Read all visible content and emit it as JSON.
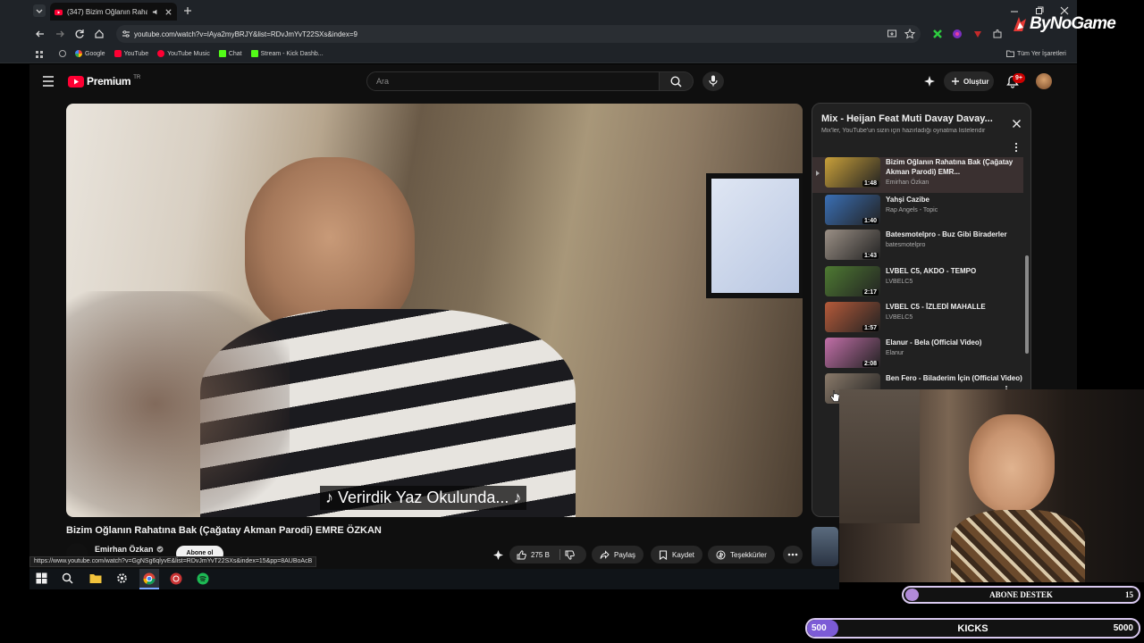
{
  "browser": {
    "tab_title": "(347) Bizim Oğlanın Rahatı",
    "url": "youtube.com/watch?v=lAya2myBRJY&list=RDvJmYvT22SXs&index=9",
    "bookmarks": [
      "Google",
      "YouTube",
      "YouTube Music",
      "Chat",
      "Stream - Kick Dashb..."
    ],
    "all_bookmarks": "Tüm Yer İşaretleri"
  },
  "youtube": {
    "logo": "Premium",
    "logo_sup": "TR",
    "search_placeholder": "Ara",
    "create_label": "Oluştur",
    "notif_count": "9+",
    "subtitle": "♪ Verirdik Yaz Okulunda... ♪",
    "video_title": "Bizim Oğlanın Rahatına Bak (Çağatay Akman Parodi) EMRE ÖZKAN",
    "channel": "Emirhan Özkan",
    "subscribe_label": "Abone ol",
    "likes": "275 B",
    "share_label": "Paylaş",
    "save_label": "Kaydet",
    "thanks_label": "Teşekkürler",
    "status_url": "https://www.youtube.com/watch?v=GgNSg6qlyvE&list=RDvJmYvT22SXs&index=15&pp=8AUBoAcB"
  },
  "playlist": {
    "title": "Mix - Heijan Feat Muti Davay Davay...",
    "subtitle": "Mix'ler, YouTube'un sizin için hazırladığı oynatma listeleridir",
    "items": [
      {
        "title": "Bizim Oğlanın Rahatına Bak (Çağatay Akman Parodi) EMR...",
        "channel": "Emirhan Özkan",
        "duration": "1:48",
        "color": "#c9a03a"
      },
      {
        "title": "Yahşi Cazibe",
        "channel": "Rap Angels - Topic",
        "duration": "1:40",
        "color": "#3a6fb5"
      },
      {
        "title": "Batesmotelpro - Buz Gibi Biraderler",
        "channel": "batesmotelpro",
        "duration": "1:43",
        "color": "#9a8f85"
      },
      {
        "title": "LVBEL C5, AKDO - TEMPO",
        "channel": "LVBELC5",
        "duration": "2:17",
        "color": "#4e7a32"
      },
      {
        "title": "LVBEL C5 - İZLEDİ MAHALLE",
        "channel": "LVBELC5",
        "duration": "1:57",
        "color": "#b55a3a"
      },
      {
        "title": "Elanur - Bela (Official Video)",
        "channel": "Elanur",
        "duration": "2:08",
        "color": "#c26fa8"
      },
      {
        "title": "Ben Fero - Biladerim İçin (Official Video)",
        "channel": "",
        "duration": "",
        "color": "#8a7a6a"
      }
    ]
  },
  "overlay": {
    "brand": "ByNoGame",
    "sub_goal_label": "ABONE DESTEK",
    "sub_goal_value": "15",
    "kicks_label": "KICKS",
    "kicks_current": "500",
    "kicks_target": "5000",
    "kicks_progress": 0.1
  }
}
